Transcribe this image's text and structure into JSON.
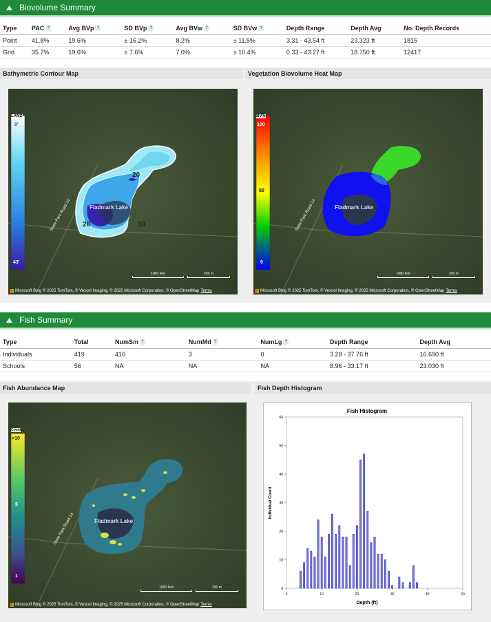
{
  "biovolume": {
    "header": "Biovolume Summary",
    "columns": [
      "Type",
      "PAC",
      "Avg BVp",
      "SD BVp",
      "Avg BVw",
      "SD BVw",
      "Depth Range",
      "Depth Avg",
      "No. Depth Records"
    ],
    "help_columns": [
      false,
      true,
      true,
      true,
      true,
      true,
      false,
      false,
      false
    ],
    "rows": [
      [
        "Point",
        "41.8%",
        "19.6%",
        "± 16.2%",
        "8.2%",
        "± 11.5%",
        "3.31 - 43.54 ft",
        "23.323 ft",
        "1815"
      ],
      [
        "Grid",
        "35.7%",
        "19.6%",
        "± 7.6%",
        "7.0%",
        "± 10.4%",
        "0.33 - 43.27 ft",
        "18.750 ft",
        "12417"
      ]
    ]
  },
  "contour_map": {
    "title": "Bathymetric Contour Map",
    "legend_top": "LAND",
    "legend_top_value": "0'",
    "legend_bottom_value": "43'",
    "contour_labels": [
      "20",
      "20",
      "10"
    ],
    "lake_name": "Fladmark Lake",
    "road_name": "State Park Road 14",
    "scale_ft": "1000 feet",
    "scale_m": "250 m",
    "credits": "Microsoft Bing",
    "credits_text": "© 2025 TomTom, © Vexcel Imaging, © 2025 Microsoft Corporation, © OpenStreetMap",
    "terms": "Terms"
  },
  "heat_map": {
    "title": "Vegetation Biovolume Heat Map",
    "legend_title": "BV%",
    "legend_top": "100",
    "legend_mid": "50",
    "legend_bottom": "0",
    "lake_name": "Fladmark Lake",
    "road_name": "State Park Road 14",
    "scale_ft": "1000 feet",
    "scale_m": "250 m",
    "credits": "Microsoft Bing",
    "credits_text": "© 2025 TomTom, © Vexcel Imaging, © 2025 Microsoft Corporation, © OpenStreetMap",
    "terms": "Terms"
  },
  "fish": {
    "header": "Fish Summary",
    "columns": [
      "Type",
      "Total",
      "NumSm",
      "NumMd",
      "NumLg",
      "Depth Range",
      "Depth Avg"
    ],
    "help_columns": [
      false,
      false,
      true,
      true,
      true,
      false,
      false
    ],
    "rows": [
      [
        "Individuals",
        "419",
        "416",
        "3",
        "0",
        "3.28 - 37.76 ft",
        "16.690 ft"
      ],
      [
        "Schools",
        "56",
        "NA",
        "NA",
        "NA",
        "8.96 - 33.17 ft",
        "23.030 ft"
      ]
    ]
  },
  "abundance_map": {
    "title": "Fish Abundance Map",
    "legend_title": "Count",
    "legend_top": ">10",
    "legend_mid": "5",
    "legend_bottom": "1",
    "lake_name": "Fladmark Lake",
    "road_name": "State Park Road 14",
    "scale_ft": "1000 feet",
    "scale_m": "250 m",
    "credits": "Microsoft Bing",
    "credits_text": "© 2025 TomTom, © Vexcel Imaging, © 2025 Microsoft Corporation, © OpenStreetMap",
    "terms": "Terms"
  },
  "histogram_panel": {
    "title": "Fish Depth Histogram"
  },
  "colors": {
    "header_green": "#1f8a3a",
    "bar_fill": "#7777dd",
    "bar_stroke": "#2222aa"
  },
  "chart_data": {
    "type": "bar",
    "title": "Fish Histogram",
    "xlabel": "Depth (ft)",
    "ylabel": "Individual Count",
    "xlim": [
      0,
      50
    ],
    "ylim": [
      0,
      60
    ],
    "xticks": [
      0,
      10,
      20,
      30,
      40,
      50
    ],
    "yticks": [
      0,
      10,
      20,
      30,
      40,
      50,
      60
    ],
    "grid": false,
    "x": [
      4,
      5,
      6,
      7,
      8,
      9,
      10,
      11,
      12,
      13,
      14,
      15,
      16,
      17,
      18,
      19,
      20,
      21,
      22,
      23,
      24,
      25,
      26,
      27,
      28,
      29,
      30,
      32,
      33,
      35,
      36,
      37
    ],
    "values": [
      6,
      9,
      14,
      13,
      11,
      24,
      18,
      11,
      19,
      26,
      19,
      22,
      18,
      18,
      8,
      19,
      22,
      45,
      47,
      27,
      16,
      18,
      12,
      12,
      10,
      6,
      1,
      4,
      2,
      2,
      8,
      2
    ]
  }
}
